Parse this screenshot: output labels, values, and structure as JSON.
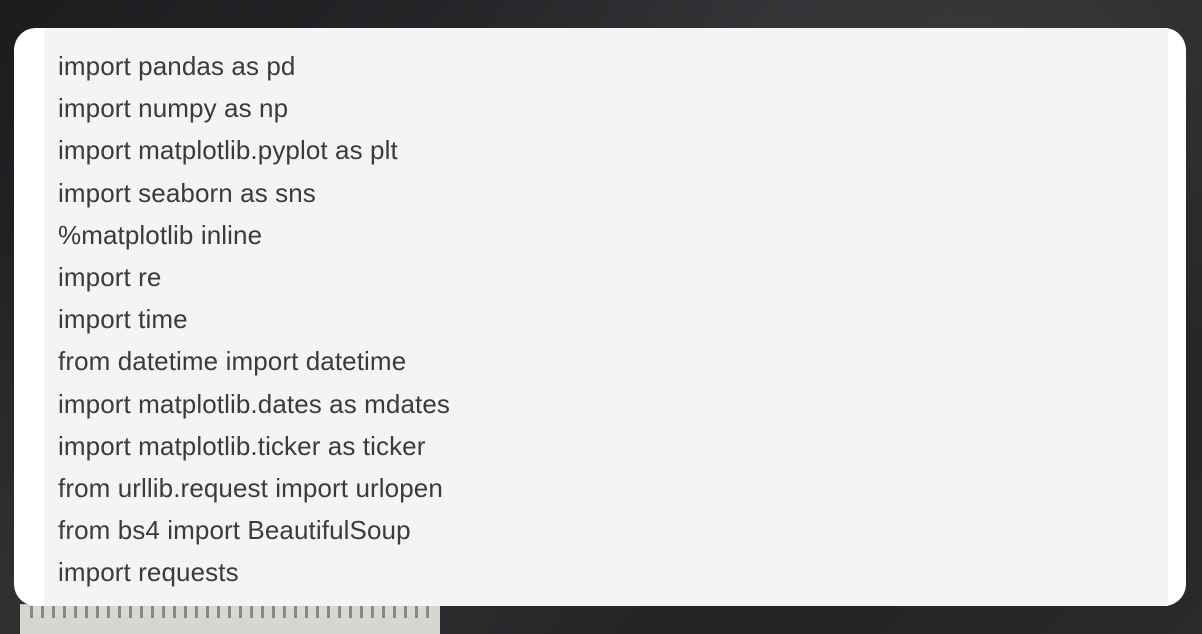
{
  "code_block": {
    "lines": [
      "import pandas as pd",
      "import numpy as np",
      "import matplotlib.pyplot as plt",
      "import seaborn as sns",
      "%matplotlib inline",
      "import re",
      "import time",
      "from datetime import datetime",
      "import matplotlib.dates as mdates",
      "import matplotlib.ticker as ticker",
      "from urllib.request import urlopen",
      "from bs4 import BeautifulSoup",
      "import requests"
    ]
  },
  "colors": {
    "card_background": "#ffffff",
    "code_background": "#f4f4f4",
    "code_text": "#3b3b3b",
    "page_background": "#1f2123"
  }
}
